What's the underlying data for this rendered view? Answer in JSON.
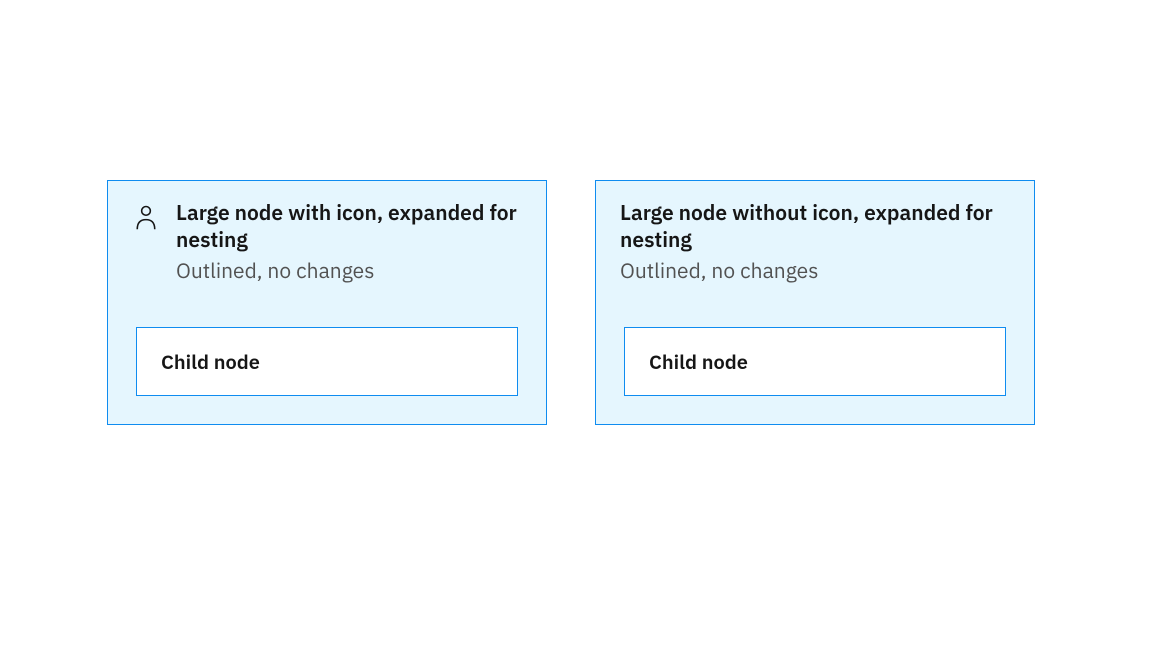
{
  "colors": {
    "border": "#0f8cf0",
    "cardBg": "#e5f6fe",
    "childBg": "#ffffff",
    "textPrimary": "#161616",
    "textSecondary": "#525252"
  },
  "nodes": [
    {
      "hasIcon": true,
      "iconName": "user-icon",
      "title": "Large node with icon, expanded for nesting",
      "subtitle": "Outlined, no changes",
      "child": {
        "label": "Child node"
      }
    },
    {
      "hasIcon": false,
      "title": "Large node without icon, expanded for nesting",
      "subtitle": "Outlined, no changes",
      "child": {
        "label": "Child node"
      }
    }
  ]
}
